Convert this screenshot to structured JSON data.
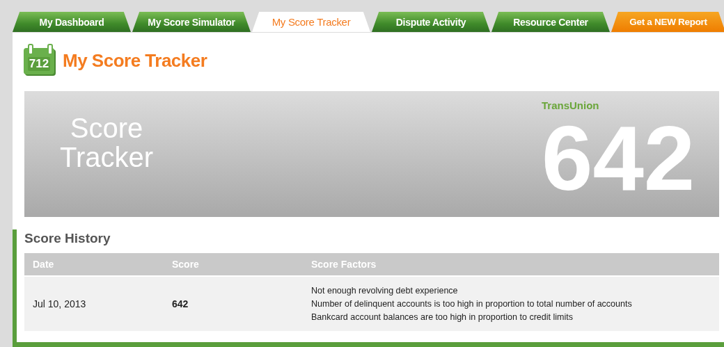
{
  "tabs": [
    {
      "label": "My Dashboard",
      "kind": "nav",
      "selected": false
    },
    {
      "label": "My Score Simulator",
      "kind": "nav",
      "selected": false
    },
    {
      "label": "My Score Tracker",
      "kind": "nav",
      "selected": true
    },
    {
      "label": "Dispute Activity",
      "kind": "nav",
      "selected": false
    },
    {
      "label": "Resource Center",
      "kind": "nav",
      "selected": false
    },
    {
      "label": "Get a NEW Report",
      "kind": "promo",
      "selected": false
    }
  ],
  "page_title": {
    "icon_number": "712",
    "title": "My Score Tracker"
  },
  "banner": {
    "title": "Score Tracker",
    "bureau": "TransUnion",
    "score": "642"
  },
  "score_history": {
    "title": "Score History",
    "columns": [
      "Date",
      "Score",
      "Score Factors"
    ],
    "rows": [
      {
        "date": "Jul 10, 2013",
        "score": "642",
        "factors": [
          "Not enough revolving debt experience",
          "Number of delinquent accounts is too high in proportion to total number of accounts",
          "Bankcard account balances are too high in proportion to credit limits"
        ]
      }
    ]
  }
}
